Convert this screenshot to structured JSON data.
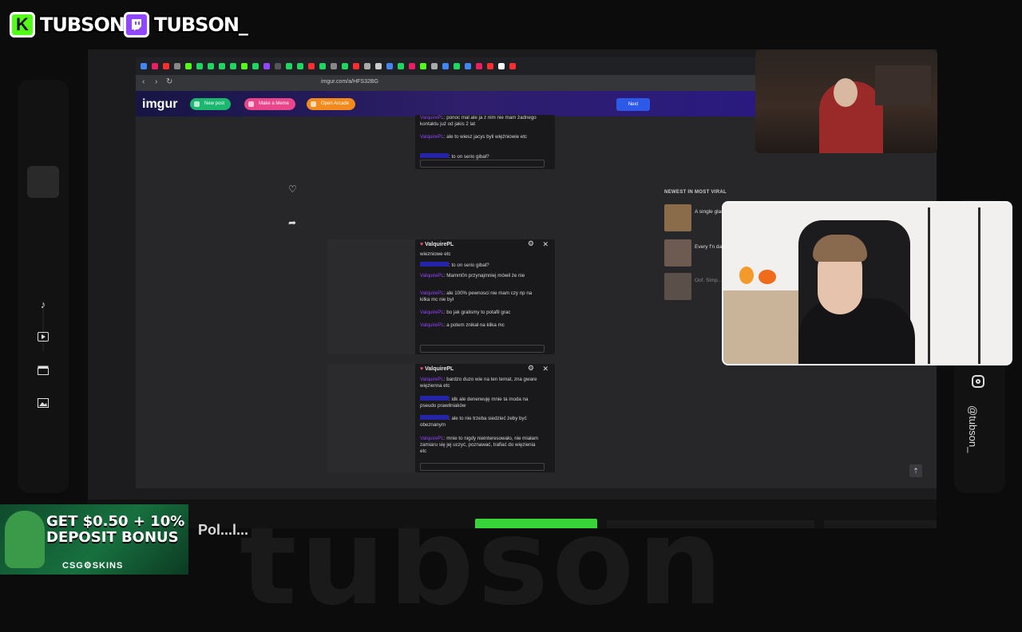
{
  "overlay": {
    "kick_handle": "TUBSON",
    "twitch_handle": "TUBSON_",
    "watermark": "tubson",
    "instagram_handle": "@tubson_",
    "bottom_label": "Pol...l..."
  },
  "browser": {
    "url": "imgur.com/a/HFS32BG",
    "imgur_logo": "imgur",
    "buttons": {
      "new_post": "New post",
      "make_meme": "Make a Meme",
      "open_arcade": "Open Arcade",
      "next": "Next"
    }
  },
  "chats": [
    {
      "user": "",
      "messages": [
        {
          "user": "ValquirePL",
          "text": ": ponoc mal ale ja z nim nie mam żadnego kontaktu już od jakis 2 lat"
        },
        {
          "user": "ValquirePL",
          "text": ": ale to wiesz jacys byli więźniowie etc"
        },
        {
          "user": "",
          "text": ": to on serio gibał?"
        }
      ]
    },
    {
      "user": "ValquirePL",
      "messages": [
        {
          "user": "",
          "text": "wiezniowe etc"
        },
        {
          "user": "",
          "text": ": to on serio gibał?"
        },
        {
          "user": "ValquirePL",
          "text": ": Mamm0n przynajmniej mówił że nie"
        },
        {
          "user": "ValquirePL",
          "text": ": ale 100% pewnosci nie mam czy np na kilka mc nie był"
        },
        {
          "user": "ValquirePL",
          "text": ": bo jak gralismy to potafil grac"
        },
        {
          "user": "ValquirePL",
          "text": ": a potem znikał na kilka mc"
        }
      ]
    },
    {
      "user": "ValquirePL",
      "messages": [
        {
          "user": "ValquirePL",
          "text": ": bardzo duzo wie na ten temat, zna gware więzienna etc"
        },
        {
          "user": "",
          "text": ": idk ale denerwuję mnie ta moda na pseudo prawilniaków"
        },
        {
          "user": "",
          "text": ": ale to nie trzeba siedzieć żeby być obeznanym"
        },
        {
          "user": "ValquirePL",
          "text": ": mnie to nigdy nieinteresowało, nie miałam zamiaru się jej uczyć, poznawać, trafiać do więzienia etc"
        }
      ]
    }
  ],
  "viral": {
    "title": "NEWEST IN MOST VIRAL",
    "items": [
      {
        "text": "A single glance can tell a story all its own."
      },
      {
        "text": "Every f'n day for years."
      },
      {
        "text": "Oof. Simp... though."
      }
    ]
  },
  "ad": {
    "headline_1": "GET $0.50 + 10%",
    "headline_2": "DEPOSIT BONUS",
    "brand": "CSG⚙SKINS"
  },
  "colors": {
    "kick_green": "#53fc18",
    "twitch_purple": "#9146ff",
    "imgur_next_blue": "#2d59e8",
    "green_bar": "#38d339"
  }
}
